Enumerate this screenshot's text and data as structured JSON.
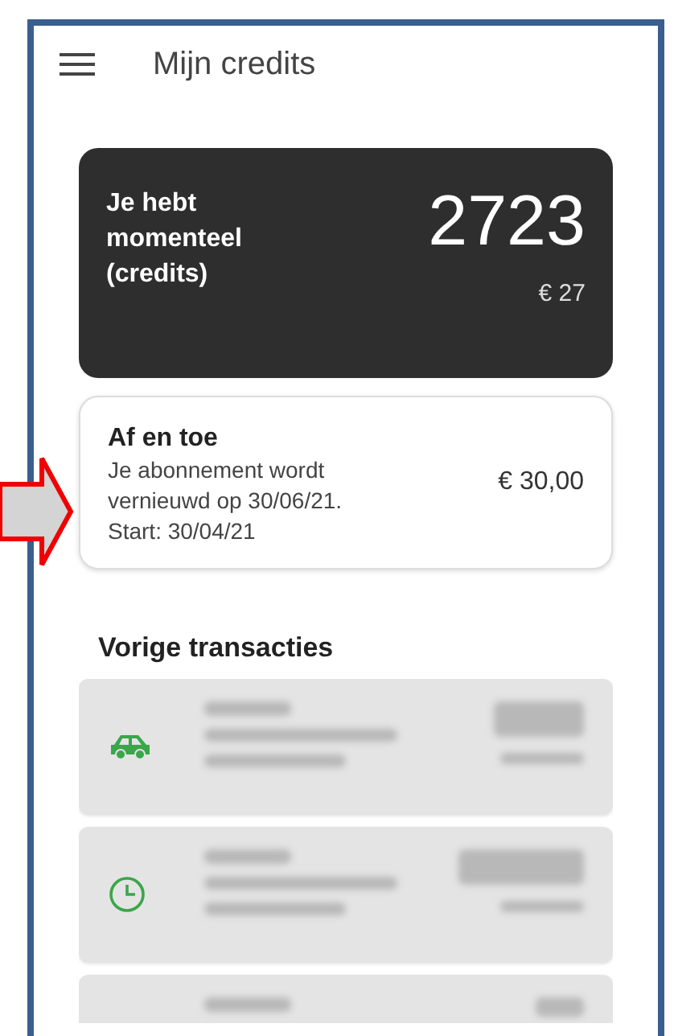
{
  "header": {
    "title": "Mijn credits"
  },
  "balance": {
    "label": "Je hebt momenteel (credits)",
    "credits": "2723",
    "amount": "€ 27"
  },
  "subscription": {
    "title": "Af en toe",
    "description": "Je abonnement wordt vernieuwd op 30/06/21.",
    "start": "Start: 30/04/21",
    "price": "€ 30,00"
  },
  "transactions": {
    "title": "Vorige transacties",
    "items": [
      {
        "kind": "car"
      },
      {
        "kind": "clock"
      },
      {
        "kind": "partial"
      }
    ]
  }
}
